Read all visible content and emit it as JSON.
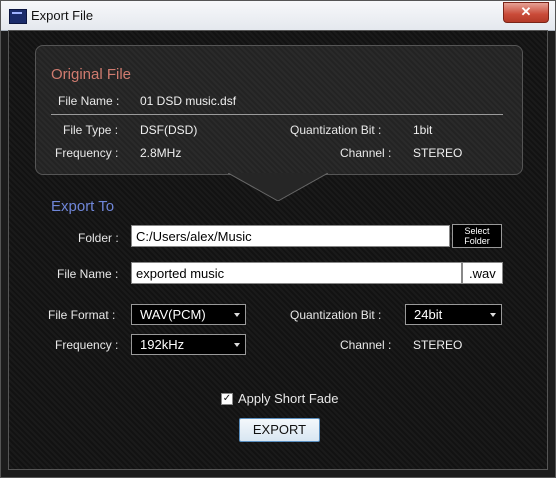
{
  "window": {
    "title": "Export File",
    "close_glyph": "✕"
  },
  "original": {
    "heading": "Original File",
    "file_name_label": "File Name :",
    "file_name": "01 DSD music.dsf",
    "file_type_label": "File Type :",
    "file_type": "DSF(DSD)",
    "quant_label": "Quantization Bit :",
    "quant": "1bit",
    "freq_label": "Frequency :",
    "freq": "2.8MHz",
    "channel_label": "Channel :",
    "channel": "STEREO"
  },
  "export": {
    "heading": "Export To",
    "folder_label": "Folder :",
    "folder_value": "C:/Users/alex/Music",
    "select_folder_line1": "Select",
    "select_folder_line2": "Folder",
    "filename_label": "File Name :",
    "filename_value": "exported music",
    "extension": ".wav",
    "format_label": "File Format :",
    "format_value": "WAV(PCM)",
    "quant_label": "Quantization Bit :",
    "quant_value": "24bit",
    "freq_label": "Frequency :",
    "freq_value": "192kHz",
    "channel_label": "Channel :",
    "channel_value": "STEREO",
    "fade_label": "Apply Short Fade",
    "fade_checked": true,
    "check_glyph": "✓",
    "export_button": "EXPORT"
  },
  "colors": {
    "accent_original": "#d07b6f",
    "accent_export": "#6f86d8"
  }
}
